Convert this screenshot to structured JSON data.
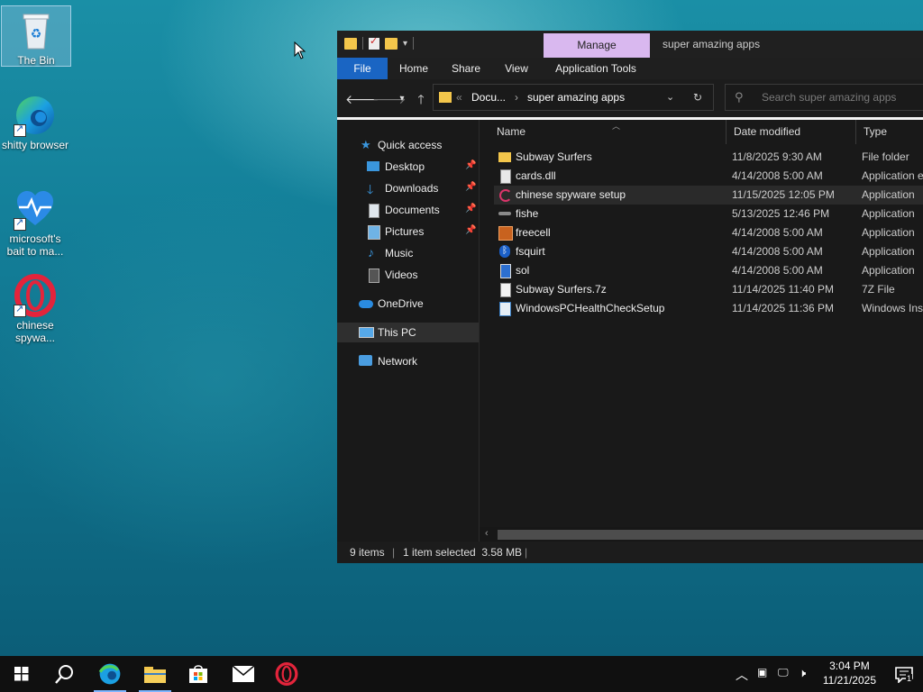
{
  "desktop": {
    "icons": [
      {
        "label": "The Bin"
      },
      {
        "label": "shitty browser"
      },
      {
        "label": "microsoft's bait to ma..."
      },
      {
        "label": "chinese spywa..."
      }
    ]
  },
  "explorer": {
    "title": "super amazing apps",
    "context_tab": "Manage",
    "ribbon_tabs": [
      "File",
      "Home",
      "Share",
      "View",
      "Application Tools"
    ],
    "address": {
      "crumb_parent": "Docu...",
      "crumb_current": "super amazing apps"
    },
    "search_placeholder": "Search super amazing apps",
    "nav_pane": [
      {
        "label": "Quick access",
        "icon": "star-icon",
        "pinned": false
      },
      {
        "label": "Desktop",
        "icon": "desktop-icon",
        "pinned": true
      },
      {
        "label": "Downloads",
        "icon": "download-icon",
        "pinned": true
      },
      {
        "label": "Documents",
        "icon": "document-icon",
        "pinned": true
      },
      {
        "label": "Pictures",
        "icon": "picture-icon",
        "pinned": true
      },
      {
        "label": "Music",
        "icon": "music-icon",
        "pinned": false
      },
      {
        "label": "Videos",
        "icon": "video-icon",
        "pinned": false
      },
      {
        "label": "OneDrive",
        "icon": "cloud-icon",
        "pinned": false
      },
      {
        "label": "This PC",
        "icon": "computer-icon",
        "pinned": false,
        "selected": true
      },
      {
        "label": "Network",
        "icon": "network-icon",
        "pinned": false
      }
    ],
    "columns": [
      "Name",
      "Date modified",
      "Type"
    ],
    "files": [
      {
        "name": "Subway Surfers",
        "date": "11/8/2025 9:30 AM",
        "type": "File folder",
        "icon": "folder-icon"
      },
      {
        "name": "cards.dll",
        "date": "4/14/2008 5:00 AM",
        "type": "Application e",
        "icon": "dll-file-icon"
      },
      {
        "name": "chinese spyware setup",
        "date": "11/15/2025 12:05 PM",
        "type": "Application",
        "icon": "opera-setup-icon",
        "highlighted": true
      },
      {
        "name": "fishe",
        "date": "5/13/2025 12:46 PM",
        "type": "Application",
        "icon": "fish-icon"
      },
      {
        "name": "freecell",
        "date": "4/14/2008 5:00 AM",
        "type": "Application",
        "icon": "freecell-icon"
      },
      {
        "name": "fsquirt",
        "date": "4/14/2008 5:00 AM",
        "type": "Application",
        "icon": "bluetooth-icon"
      },
      {
        "name": "sol",
        "date": "4/14/2008 5:00 AM",
        "type": "Application",
        "icon": "solitaire-icon"
      },
      {
        "name": "Subway Surfers.7z",
        "date": "11/14/2025 11:40 PM",
        "type": "7Z File",
        "icon": "file-icon"
      },
      {
        "name": "WindowsPCHealthCheckSetup",
        "date": "11/14/2025 11:36 PM",
        "type": "Windows Ins",
        "icon": "installer-icon"
      }
    ],
    "status": {
      "count": "9 items",
      "selection": "1 item selected  3.58 MB"
    }
  },
  "taskbar": {
    "time": "3:04 PM",
    "date": "11/21/2025",
    "notification_count": "1"
  },
  "colors": {
    "accent": "#1a65c3",
    "manage_tab": "#d9b8ef",
    "folder": "#f3c64b"
  }
}
